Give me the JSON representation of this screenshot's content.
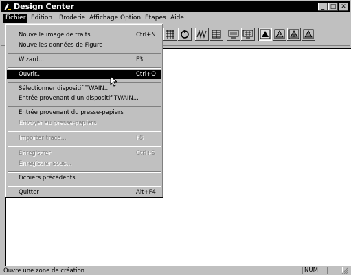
{
  "window": {
    "title": "Design Center"
  },
  "caption_buttons": {
    "minimize": "_",
    "maximize": "□",
    "close": "✕"
  },
  "menubar": {
    "items": [
      {
        "label": "Fichier"
      },
      {
        "label": "Edition"
      },
      {
        "label": "Broderie"
      },
      {
        "label": "Affichage"
      },
      {
        "label": "Option"
      },
      {
        "label": "Etapes"
      },
      {
        "label": "Aide"
      }
    ]
  },
  "file_menu": {
    "items": [
      {
        "label": "Nouvelle image de traits",
        "shortcut": "Ctrl+N"
      },
      {
        "label": "Nouvelles données de Figure",
        "shortcut": ""
      },
      {
        "label": "Wizard...",
        "shortcut": "F3"
      },
      {
        "label": "Ouvrir...",
        "shortcut": "Ctrl+O"
      },
      {
        "label": "Sélectionner dispositif TWAIN...",
        "shortcut": ""
      },
      {
        "label": "Entrée provenant d'un dispositif TWAIN...",
        "shortcut": ""
      },
      {
        "label": "Entrée provenant du presse-papiers",
        "shortcut": ""
      },
      {
        "label": "Envoyer au presse-papiers",
        "shortcut": ""
      },
      {
        "label": "Importer trace...",
        "shortcut": "F8"
      },
      {
        "label": "Enregistrer",
        "shortcut": "Ctrl+S"
      },
      {
        "label": "Enregistrer sous...",
        "shortcut": ""
      },
      {
        "label": "Fichiers précédents",
        "shortcut": ""
      },
      {
        "label": "Quitter",
        "shortcut": "Alt+F4"
      }
    ]
  },
  "toolbar": {
    "icons": [
      "grid-icon",
      "undo-icon",
      "zigzag-stitch-icon",
      "fill-stitch-icon",
      "monitor-icon",
      "monitor-grid-icon",
      "figure-a-icon",
      "figure-hatch-icon",
      "figure-grid-icon",
      "figure-b-icon"
    ]
  },
  "statusbar": {
    "text": "Ouvre une zone de création",
    "num": "NUM"
  },
  "colors": {
    "face": "#c0c0c0",
    "highlight": "#000000",
    "disabled": "#808080"
  }
}
